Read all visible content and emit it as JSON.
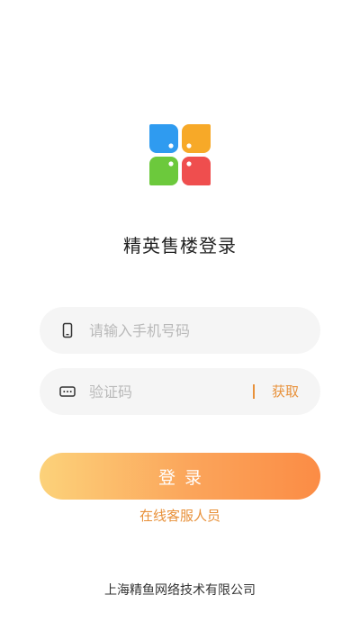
{
  "app": {
    "logo_icon": "four-petal-logo-icon",
    "logo_colors": [
      "#2f9bf0",
      "#f7a928",
      "#6cc93c",
      "#ef4e4e"
    ],
    "title": "精英售楼登录"
  },
  "form": {
    "phone": {
      "icon": "phone-icon",
      "placeholder": "请输入手机号码",
      "value": ""
    },
    "code": {
      "icon": "verification-code-icon",
      "placeholder": "验证码",
      "value": "",
      "get_code_label": "获取"
    },
    "login_label": "登录",
    "support_link": "在线客服人员"
  },
  "footer": {
    "company": "上海精鱼网络技术有限公司"
  },
  "colors": {
    "accent": "#e8913a",
    "button_gradient_start": "#fcd27a",
    "button_gradient_end": "#fb8c45",
    "field_background": "#f5f5f5"
  }
}
